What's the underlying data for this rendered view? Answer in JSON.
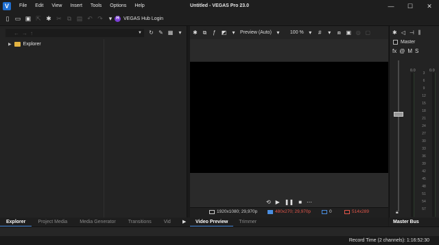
{
  "app": {
    "logo": "V",
    "title": "Untitled - VEGAS Pro 23.0",
    "menu": [
      "File",
      "Edit",
      "View",
      "Insert",
      "Tools",
      "Options",
      "Help"
    ],
    "window_controls": [
      "—",
      "☐",
      "✕"
    ]
  },
  "toolbar": {
    "hub_badge": "H",
    "hub_label": "VEGAS Hub Login"
  },
  "explorer": {
    "tree_item": "Explorer",
    "tabs": [
      "Explorer",
      "Project Media",
      "Media Generator",
      "Transitions",
      "Vid"
    ],
    "active_tab": "Explorer"
  },
  "preview": {
    "quality": "Preview (Auto)",
    "zoom": "100 %",
    "project_res": "1920x1080; 29,970p",
    "preview_res": "480x270; 29,970p",
    "frame_count": "0",
    "display_size": "514x289",
    "tabs": [
      "Video Preview",
      "Trimmer"
    ],
    "active_tab": "Video Preview",
    "colors": {
      "accent_red": "#e3564a",
      "accent_blue": "#4b8fe2"
    }
  },
  "master_bus": {
    "label": "Master",
    "fx": "fx",
    "mute": "M",
    "solo": "S",
    "meter_left": "0.0",
    "meter_right": "0.0",
    "scale": [
      "3",
      "6",
      "9",
      "12",
      "15",
      "18",
      "21",
      "24",
      "27",
      "30",
      "33",
      "36",
      "39",
      "42",
      "45",
      "48",
      "51",
      "54",
      "57"
    ],
    "tab": "Master Bus"
  },
  "status": {
    "record_time": "Record Time (2 channels): 1:16:52:30"
  }
}
